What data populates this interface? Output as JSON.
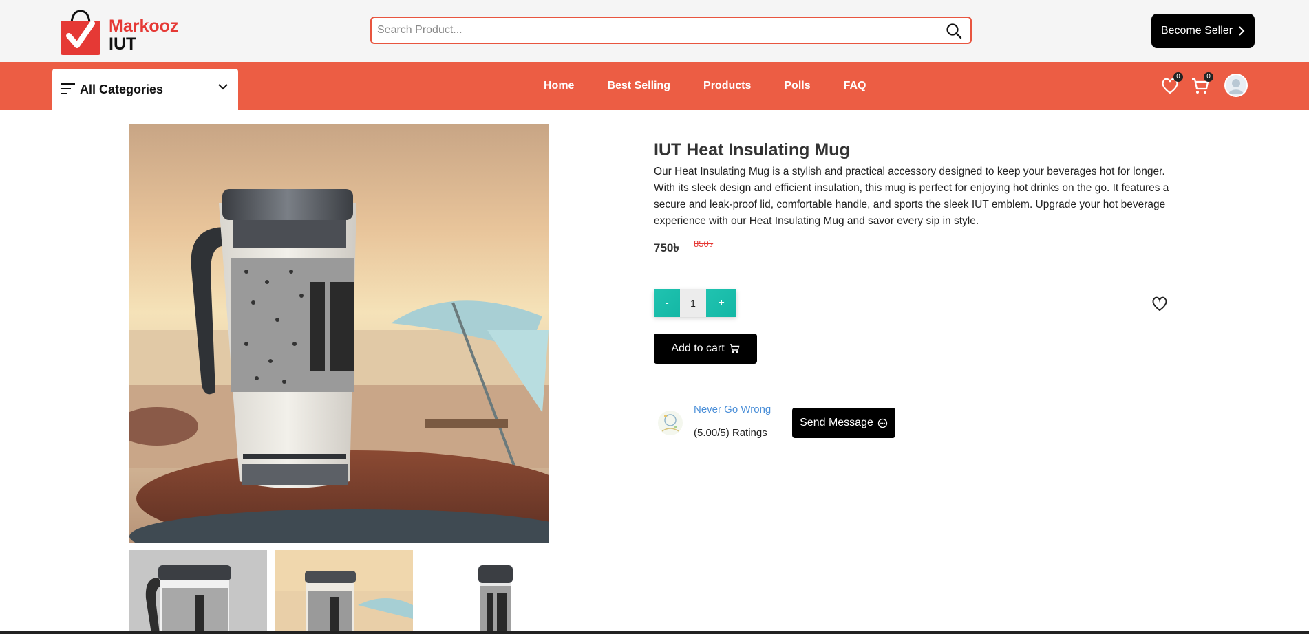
{
  "brand": {
    "name_line1": "Markooz",
    "name_line2": "IUT",
    "accent": "#e53935"
  },
  "search": {
    "placeholder": "Search Product..."
  },
  "header": {
    "become_seller": "Become Seller"
  },
  "nav": {
    "categories_label": "All Categories",
    "links": [
      "Home",
      "Best Selling",
      "Products",
      "Polls",
      "FAQ"
    ],
    "wishlist_count": "0",
    "cart_count": "0",
    "bar_color": "#ec5d44"
  },
  "product": {
    "title": "IUT Heat Insulating Mug",
    "description": "Our Heat Insulating Mug is a stylish and practical accessory designed to keep your beverages hot for longer. With its sleek design and efficient insulation, this mug is perfect for enjoying hot drinks on the go. It features a secure and leak-proof lid, comfortable handle, and sports the sleek IUT emblem. Upgrade your hot beverage experience with our Heat Insulating Mug and savor every sip in style.",
    "price": "750৳",
    "original_price": "850৳",
    "quantity": "1",
    "minus_label": "-",
    "plus_label": "+",
    "add_to_cart": "Add to cart"
  },
  "shop": {
    "name": "Never Go Wrong",
    "rating": "(5.00/5) Ratings",
    "send_message": "Send Message"
  }
}
